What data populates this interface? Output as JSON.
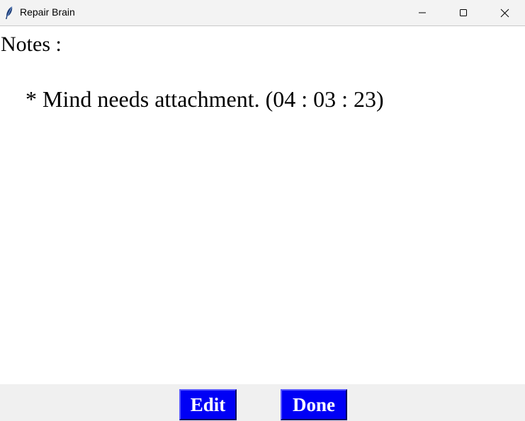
{
  "window": {
    "title": "Repair Brain",
    "icon": "feather-icon",
    "controls": {
      "minimize": "minimize-icon",
      "maximize": "maximize-icon",
      "close": "close-icon"
    }
  },
  "notes": {
    "heading": "Notes :",
    "items": [
      {
        "text": "* Mind needs attachment. (04 : 03 : 23)"
      }
    ]
  },
  "actions": {
    "edit_label": "Edit",
    "done_label": "Done",
    "button_color": "#0000f5",
    "button_text_color": "#ffffff"
  }
}
